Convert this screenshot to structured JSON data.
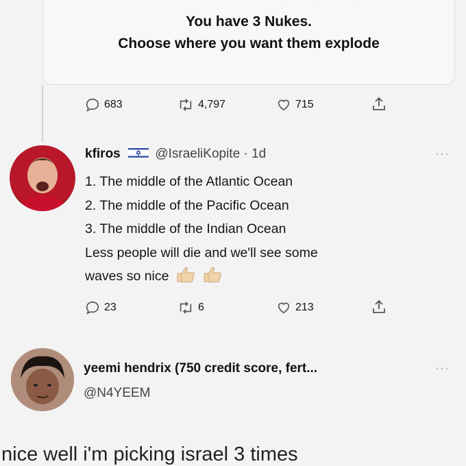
{
  "quoted_tweet": {
    "line1": "You have 3 Nukes.",
    "line2": "Choose where you want them explode",
    "icon": "radiation-icon",
    "stats": {
      "replies": "683",
      "retweets": "4,797",
      "likes": "715"
    }
  },
  "tweet1": {
    "display_name": "kfiros",
    "flag_icon": "israel-flag-icon",
    "handle_time": "@IsraeliKopite · 1d",
    "lines": [
      "1. The middle of the Atlantic Ocean",
      "2. The middle of the Pacific Ocean",
      "3. The middle of the Indian Ocean",
      "Less people will die and we'll see some",
      "waves so nice"
    ],
    "emoji": "thumbs-up-icon",
    "stats": {
      "replies": "23",
      "retweets": "6",
      "likes": "213"
    }
  },
  "tweet2": {
    "display_name": "yeemi hendrix (750 credit score, fert...",
    "handle": "@N4YEEM",
    "text": "nice well i'm picking israel 3 times"
  },
  "more_label": "···",
  "colors": {
    "background": "#f3f3f3",
    "icon": "#555555",
    "text": "#111111"
  }
}
